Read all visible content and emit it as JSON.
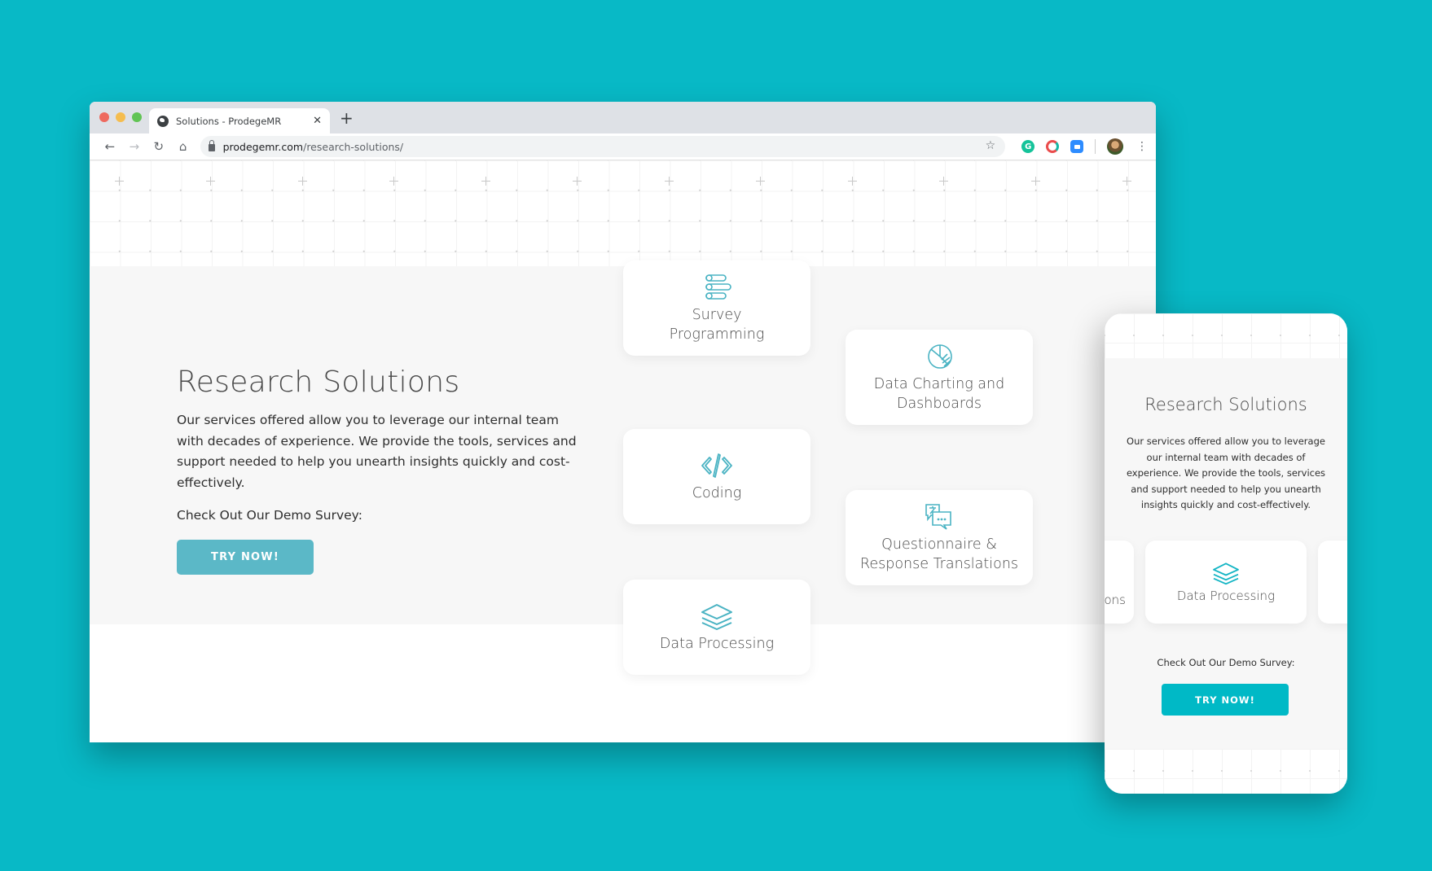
{
  "theme": {
    "background": "#08b9c6",
    "accent_desktop_button": "#5bb8c7",
    "accent_mobile_button": "#00b9c6",
    "icon_color": "#4ab3c3"
  },
  "browser": {
    "tab": {
      "title": "Solutions - ProdegeMR",
      "favicon": "globe-icon",
      "close_glyph": "✕"
    },
    "new_tab_glyph": "+",
    "nav": {
      "back": "←",
      "forward": "→",
      "reload": "↻",
      "home": "⌂"
    },
    "url": {
      "host": "prodegemr.com",
      "path": "/research-solutions/"
    },
    "bookmark_glyph": "☆",
    "extensions": [
      {
        "name": "grammarly-icon",
        "glyph": "G"
      },
      {
        "name": "extension-c-icon",
        "glyph": ""
      },
      {
        "name": "zoom-icon",
        "glyph": ""
      }
    ],
    "menu_glyph": "⋮"
  },
  "page": {
    "title": "Research Solutions",
    "description": "Our services offered allow you to leverage our internal team with decades of experience. We provide the tools, services and support needed to help you unearth insights quickly and cost-effectively.",
    "demo_label": "Check Out Our Demo Survey:",
    "cta_label": "TRY NOW!",
    "services": [
      {
        "label": "Survey Programming",
        "icon": "survey-list-icon"
      },
      {
        "label": "Data Charting and Dashboards",
        "icon": "pie-chart-icon"
      },
      {
        "label": "Coding",
        "icon": "code-icon"
      },
      {
        "label": "Questionnaire & Response Translations",
        "icon": "translate-chat-icon"
      },
      {
        "label": "Data Processing",
        "icon": "layers-icon"
      }
    ]
  },
  "mobile": {
    "title": "Research Solutions",
    "description": "Our services offered allow you to leverage our internal team with decades of experience. We provide the tools, services and support needed to help you unearth insights quickly and cost-effectively.",
    "carousel_prev_partial": "ons",
    "carousel_current": "Data Processing",
    "demo_label": "Check Out Our Demo Survey:",
    "cta_label": "TRY NOW!"
  }
}
